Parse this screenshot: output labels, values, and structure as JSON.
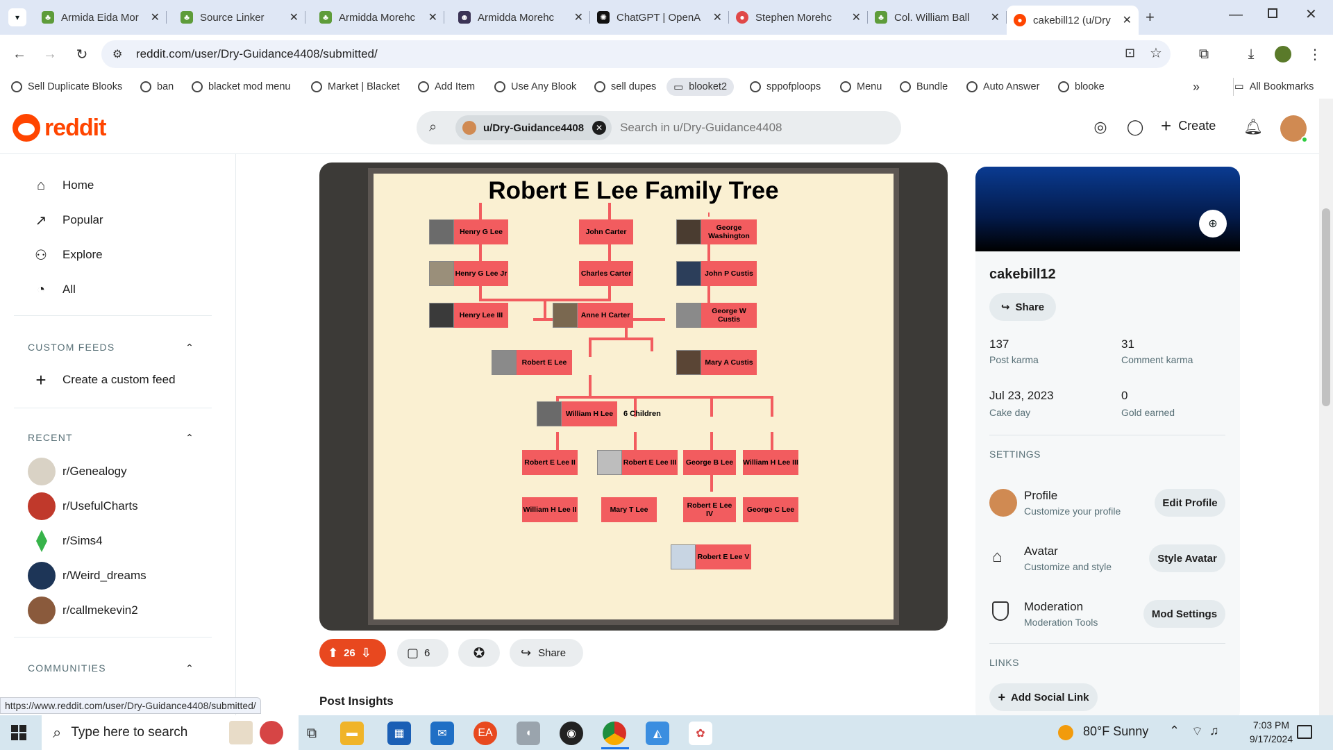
{
  "browser": {
    "tabs": [
      {
        "title": "Armida Eida Mor",
        "icon": "tree-icon",
        "color": "#5e9c3a"
      },
      {
        "title": "Source Linker",
        "icon": "tree-icon",
        "color": "#5e9c3a"
      },
      {
        "title": "Armidda Morehc",
        "icon": "tree-icon",
        "color": "#5e9c3a"
      },
      {
        "title": "Armidda Morehc",
        "icon": "portrait-icon",
        "color": "#3b3355"
      },
      {
        "title": "ChatGPT | OpenA",
        "icon": "openai-icon",
        "color": "#111111"
      },
      {
        "title": "Stephen Morehc",
        "icon": "record-icon",
        "color": "#e04848"
      },
      {
        "title": "Col. William Ball",
        "icon": "tree-icon",
        "color": "#5e9c3a"
      },
      {
        "title": "cakebill12 (u/Dry",
        "icon": "reddit-icon",
        "color": "#ff4500"
      }
    ],
    "url": "reddit.com/user/Dry-Guidance4408/submitted/",
    "bookmarks": [
      "Sell Duplicate Blooks",
      "ban",
      "blacket mod menu",
      "Market | Blacket",
      "Add Item",
      "Use Any Blook",
      "sell dupes",
      "blooket2",
      "sppofploops",
      "Menu",
      "Bundle",
      "Auto Answer",
      "blooke"
    ],
    "all_bookmarks": "All Bookmarks",
    "status_url": "https://www.reddit.com/user/Dry-Guidance4408/submitted/"
  },
  "reddit": {
    "logo_text": "reddit",
    "search_chip": "u/Dry-Guidance4408",
    "search_placeholder": "Search in u/Dry-Guidance4408",
    "create_label": "Create",
    "nav": [
      "Home",
      "Popular",
      "Explore",
      "All"
    ],
    "custom_feeds_header": "CUSTOM FEEDS",
    "create_feed": "Create a custom feed",
    "recent_header": "RECENT",
    "recent": [
      {
        "name": "r/Genealogy",
        "color": "#d9d2c5"
      },
      {
        "name": "r/UsefulCharts",
        "color": "#c0392b"
      },
      {
        "name": "r/Sims4",
        "color": "#37b34a"
      },
      {
        "name": "r/Weird_dreams",
        "color": "#1d3557"
      },
      {
        "name": "r/callmekevin2",
        "color": "#8a5a3c"
      }
    ],
    "communities_header": "COMMUNITIES"
  },
  "post": {
    "chart_title": "Robert E Lee Family Tree",
    "nodes": {
      "henry_g_lee": "Henry G Lee",
      "henry_g_lee_jr": "Henry G Lee Jr",
      "henry_lee_iii": "Henry Lee III",
      "john_carter": "John Carter",
      "charles_carter": "Charles Carter",
      "anne_h_carter": "Anne H Carter",
      "george_washington": "George Washington",
      "john_p_custis": "John P Custis",
      "george_w_custis": "George W Custis",
      "robert_e_lee": "Robert E Lee",
      "mary_a_custis": "Mary A Custis",
      "william_h_lee": "William H Lee",
      "six_children": "6 Children",
      "robert_e_lee_ii": "Robert E Lee II",
      "robert_e_lee_iii": "Robert E Lee III",
      "george_b_lee": "George B Lee",
      "william_h_lee_iii": "William H Lee III",
      "william_h_lee_ii": "William H Lee II",
      "mary_t_lee": "Mary T Lee",
      "robert_e_lee_iv": "Robert E Lee IV",
      "george_c_lee": "George C Lee",
      "robert_e_lee_v": "Robert E Lee V"
    },
    "upvotes": "26",
    "comments": "6",
    "share_label": "Share",
    "insights_label": "Post Insights"
  },
  "profile": {
    "username": "cakebill12",
    "share_label": "Share",
    "post_karma": "137",
    "post_karma_label": "Post karma",
    "comment_karma": "31",
    "comment_karma_label": "Comment karma",
    "cake_day": "Jul 23, 2023",
    "cake_day_label": "Cake day",
    "gold": "0",
    "gold_label": "Gold earned",
    "settings_header": "SETTINGS",
    "settings": [
      {
        "title": "Profile",
        "sub": "Customize your profile",
        "button": "Edit Profile"
      },
      {
        "title": "Avatar",
        "sub": "Customize and style",
        "button": "Style Avatar"
      },
      {
        "title": "Moderation",
        "sub": "Moderation Tools",
        "button": "Mod Settings"
      }
    ],
    "links_header": "LINKS",
    "add_link": "Add Social Link"
  },
  "taskbar": {
    "search_placeholder": "Type here to search",
    "weather": "80°F  Sunny",
    "time": "7:03 PM",
    "date": "9/17/2024"
  }
}
